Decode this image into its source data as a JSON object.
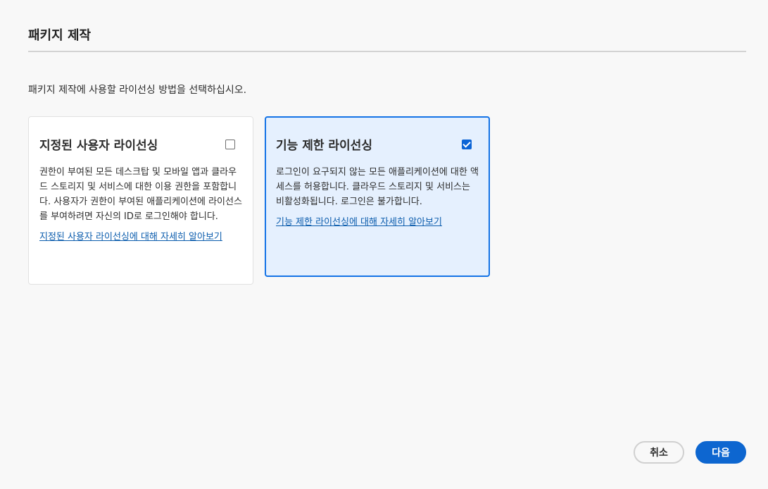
{
  "header": {
    "title": "패키지 제작"
  },
  "description": "패키지 제작에 사용할 라이선싱 방법을 선택하십시오.",
  "options": [
    {
      "title": "지정된 사용자 라이선싱",
      "checked": false,
      "body": "권한이 부여된 모든 데스크탑 및 모바일 앱과 클라우드 스토리지 및 서비스에 대한 이용 권한을 포함합니다. 사용자가 권한이 부여된 애플리케이션에 라이선스를 부여하려면 자신의 ID로 로그인해야 합니다.",
      "link": "지정된 사용자 라이선싱에 대해 자세히 알아보기"
    },
    {
      "title": "기능 제한 라이선싱",
      "checked": true,
      "body": "로그인이 요구되지 않는 모든 애플리케이션에 대한 액세스를 허용합니다. 클라우드 스토리지 및 서비스는 비활성화됩니다. 로그인은 불가합니다.",
      "link": "기능 제한 라이선싱에 대해 자세히 알아보기"
    }
  ],
  "footer": {
    "cancel_label": "취소",
    "next_label": "다음"
  },
  "colors": {
    "accent": "#0d66d0",
    "selected_card_bg": "#e5f0fe",
    "selected_card_border": "#1473e6",
    "link": "#0b5cad"
  },
  "icons": {
    "checkbox_unchecked": "checkbox-unchecked-icon",
    "checkbox_checked": "checkbox-checked-icon"
  }
}
